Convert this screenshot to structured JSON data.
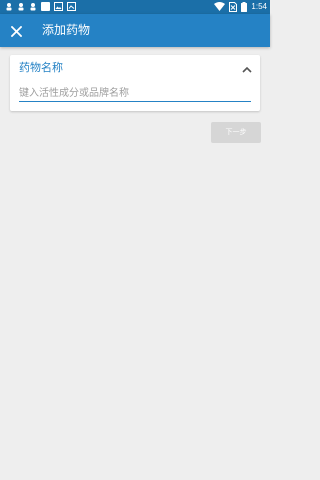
{
  "status_bar": {
    "time": "1:54",
    "left_icons": [
      "notification-icon",
      "notification-icon",
      "notification-icon",
      "app-icon",
      "image-icon",
      "image-icon"
    ],
    "right_icons": [
      "wifi-icon",
      "no-sim-icon",
      "battery-icon"
    ],
    "background": "#1b6fa8"
  },
  "app_bar": {
    "title": "添加药物",
    "close_icon": "close-icon",
    "background": "#2582c5"
  },
  "drug_card": {
    "title": "药物名称",
    "collapse_icon": "chevron-up-icon",
    "input_placeholder": "键入活性成分或品牌名称",
    "input_value": "",
    "accent": "#2582c5"
  },
  "actions": {
    "next_label": "下一步",
    "next_enabled": false
  }
}
